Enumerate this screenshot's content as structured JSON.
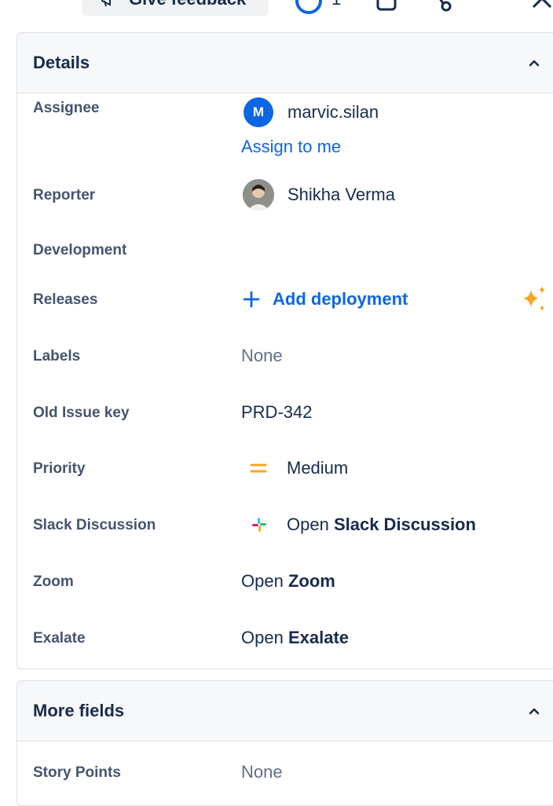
{
  "toolbar": {
    "feedback_label": "Give feedback",
    "watch_count": "1"
  },
  "details": {
    "title": "Details",
    "fields": {
      "assignee": {
        "label": "Assignee",
        "avatar_initial": "M",
        "value": "marvic.silan",
        "assign_link": "Assign to me"
      },
      "reporter": {
        "label": "Reporter",
        "value": "Shikha Verma"
      },
      "development": {
        "label": "Development"
      },
      "releases": {
        "label": "Releases",
        "action": "Add deployment"
      },
      "labels": {
        "label": "Labels",
        "value": "None"
      },
      "old_issue_key": {
        "label": "Old Issue key",
        "value": "PRD-342"
      },
      "priority": {
        "label": "Priority",
        "value": "Medium"
      },
      "slack": {
        "label": "Slack Discussion",
        "prefix": "Open",
        "bold": "Slack Discussion"
      },
      "zoom": {
        "label": "Zoom",
        "prefix": "Open",
        "bold": "Zoom"
      },
      "exalate": {
        "label": "Exalate",
        "prefix": "Open",
        "bold": "Exalate"
      }
    }
  },
  "more_fields": {
    "title": "More fields",
    "story_points": {
      "label": "Story Points",
      "value": "None"
    }
  },
  "colors": {
    "accent": "#0c66e4",
    "priority_medium": "#f5a623",
    "sparkle": "#f5a623",
    "label_text": "#44546f"
  }
}
